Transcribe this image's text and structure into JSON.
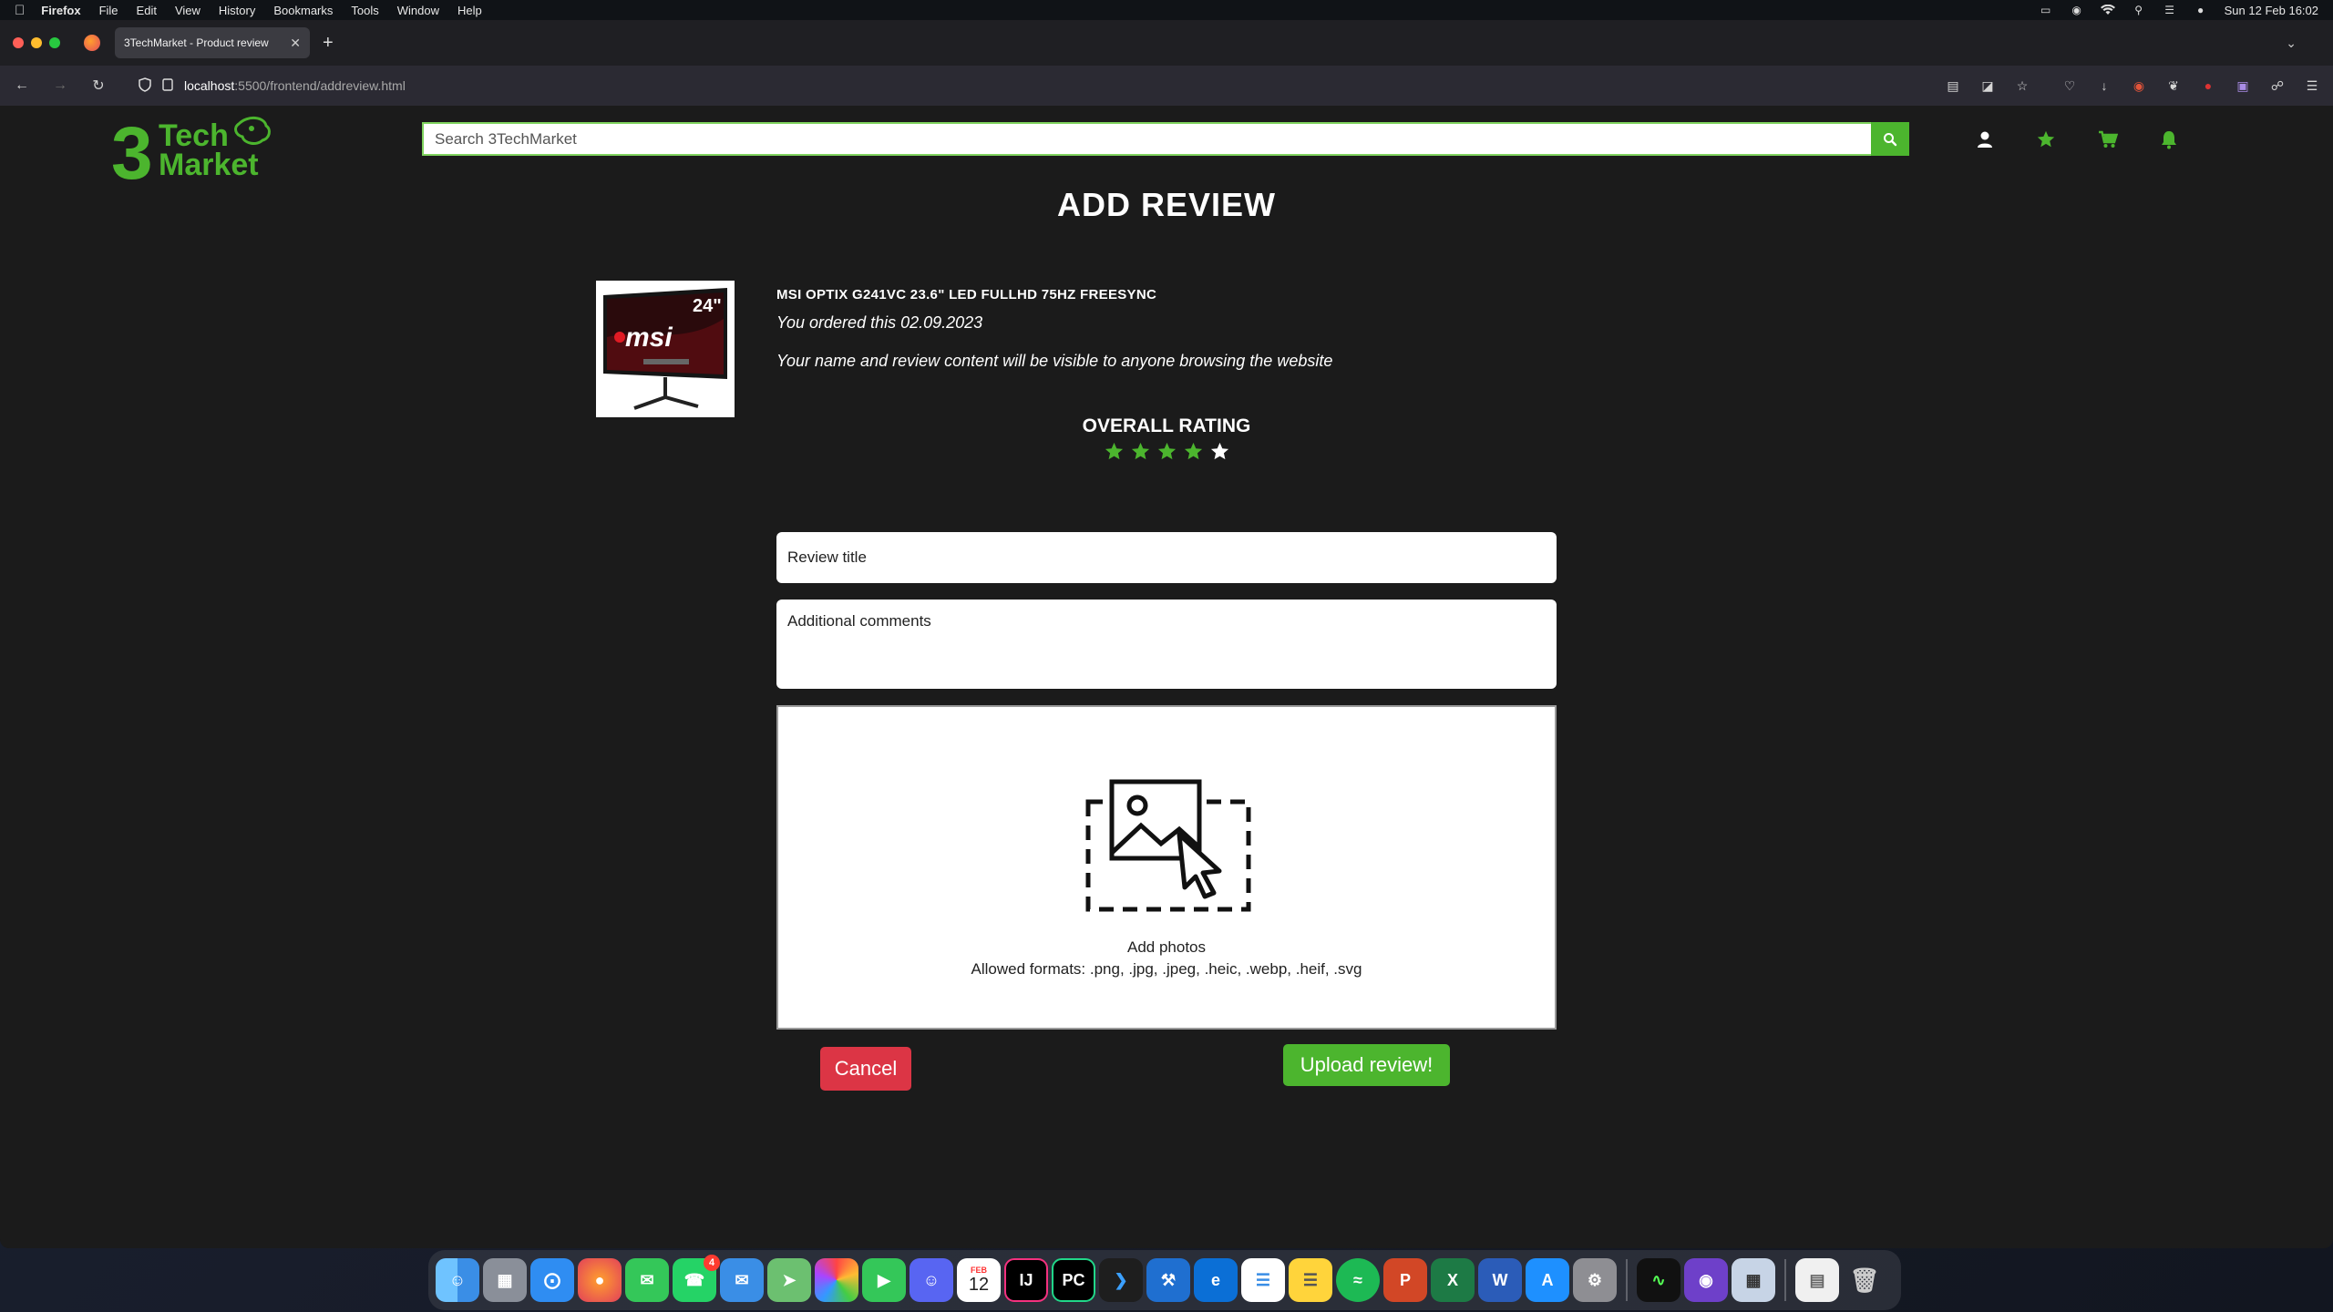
{
  "menubar": {
    "app": "Firefox",
    "items": [
      "File",
      "Edit",
      "View",
      "History",
      "Bookmarks",
      "Tools",
      "Window",
      "Help"
    ],
    "datetime": "Sun 12 Feb  16:02"
  },
  "browser": {
    "tab_title": "3TechMarket - Product review",
    "url_host": "localhost",
    "url_path": ":5500/frontend/addreview.html"
  },
  "site": {
    "logo_line1": "3",
    "logo_line2": "Tech",
    "logo_line3": "Market",
    "search_placeholder": "Search 3TechMarket",
    "accent_color": "#4cb52e"
  },
  "review": {
    "title": "ADD REVIEW",
    "product_name": "MSI OPTIX G241VC 23.6\" LED FULLHD 75HZ FREESYNC",
    "order_date_text": "You ordered this 02.09.2023",
    "privacy_note": "Your name and review content will be visible to anyone browsing the website",
    "product_image_badge": "24\"",
    "product_image_brand": "msi",
    "rating_label": "OVERALL RATING",
    "rating_value": 4,
    "rating_max": 5,
    "title_placeholder": "Review title",
    "comments_placeholder": "Additional comments",
    "dropzone_title": "Add photos",
    "dropzone_formats": "Allowed formats: .png, .jpg, .jpeg, .heic, .webp, .heif, .svg",
    "cancel_label": "Cancel",
    "upload_label": "Upload review!"
  },
  "dock": {
    "apps": [
      "Finder",
      "Launchpad",
      "Safari",
      "Firefox",
      "Messages",
      "WhatsApp",
      "Mail",
      "Maps",
      "Photos",
      "FaceTime",
      "Discord",
      "Calendar",
      "IntelliJ IDEA",
      "PyCharm",
      "VS Code",
      "Xcode",
      "Microsoft Edge",
      "Reminders",
      "Notes",
      "Spotify",
      "PowerPoint",
      "Excel",
      "Word",
      "App Store",
      "System Settings",
      "Activity Monitor",
      "GitHub Desktop",
      "Preview",
      "Documents",
      "Trash"
    ],
    "calendar_month": "FEB",
    "calendar_day": "12",
    "whatsapp_badge": "4"
  }
}
